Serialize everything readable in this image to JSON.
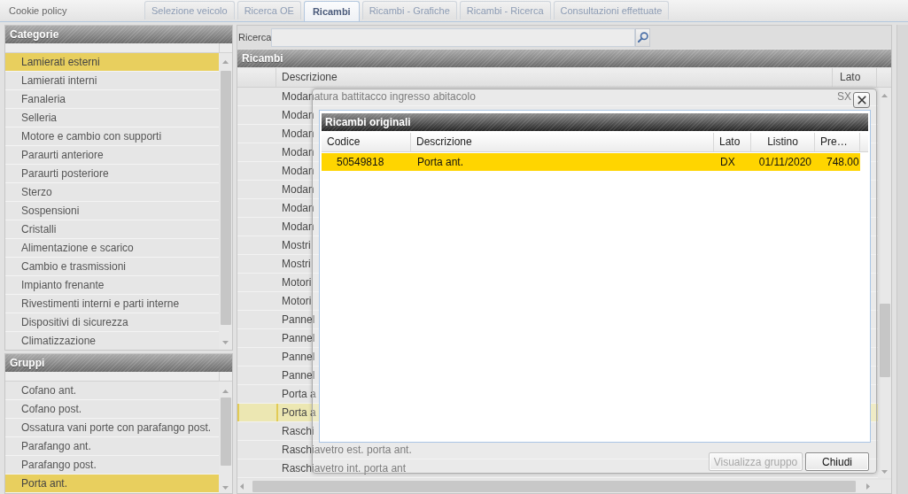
{
  "top_bar": {
    "cookie_link": "Cookie policy",
    "tabs": [
      {
        "label": "Selezione veicolo",
        "selected": false
      },
      {
        "label": "Ricerca OE",
        "selected": false
      },
      {
        "label": "Ricambi",
        "selected": true
      },
      {
        "label": "Ricambi - Grafiche",
        "selected": false
      },
      {
        "label": "Ricambi - Ricerca",
        "selected": false
      },
      {
        "label": "Consultazioni effettuate",
        "selected": false
      }
    ]
  },
  "categories": {
    "title": "Categorie",
    "items": [
      {
        "label": "Lamierati esterni",
        "selected": true
      },
      {
        "label": "Lamierati interni",
        "selected": false
      },
      {
        "label": "Fanaleria",
        "selected": false
      },
      {
        "label": "Selleria",
        "selected": false
      },
      {
        "label": "Motore e cambio con supporti",
        "selected": false
      },
      {
        "label": "Paraurti anteriore",
        "selected": false
      },
      {
        "label": "Paraurti posteriore",
        "selected": false
      },
      {
        "label": "Sterzo",
        "selected": false
      },
      {
        "label": "Sospensioni",
        "selected": false
      },
      {
        "label": "Cristalli",
        "selected": false
      },
      {
        "label": "Alimentazione e scarico",
        "selected": false
      },
      {
        "label": "Cambio e trasmissioni",
        "selected": false
      },
      {
        "label": "Impianto frenante",
        "selected": false
      },
      {
        "label": "Rivestimenti interni e parti interne",
        "selected": false
      },
      {
        "label": "Dispositivi di sicurezza",
        "selected": false
      },
      {
        "label": "Climatizzazione",
        "selected": false
      }
    ]
  },
  "groups": {
    "title": "Gruppi",
    "items": [
      {
        "label": "Cofano ant.",
        "selected": false
      },
      {
        "label": "Cofano post.",
        "selected": false
      },
      {
        "label": "Ossatura vani porte con parafango post.",
        "selected": false
      },
      {
        "label": "Parafango ant.",
        "selected": false
      },
      {
        "label": "Parafango post.",
        "selected": false
      },
      {
        "label": "Porta ant.",
        "selected": true
      }
    ]
  },
  "search": {
    "label": "Ricerca"
  },
  "parts": {
    "title": "Ricambi",
    "columns": [
      "Descrizione",
      "Lato"
    ],
    "rows": [
      {
        "description": "Modanatura battitacco ingresso abitacolo",
        "side": "SX",
        "selected": false
      },
      {
        "description": "Modan",
        "selected": false
      },
      {
        "description": "Modan",
        "selected": false
      },
      {
        "description": "Modan",
        "selected": false
      },
      {
        "description": "Modan",
        "selected": false
      },
      {
        "description": "Modan",
        "selected": false
      },
      {
        "description": "Modan",
        "selected": false
      },
      {
        "description": "Modan",
        "selected": false
      },
      {
        "description": "Mostri",
        "selected": false
      },
      {
        "description": "Mostri",
        "selected": false
      },
      {
        "description": "Motori",
        "selected": false
      },
      {
        "description": "Motori",
        "selected": false
      },
      {
        "description": "Pannel",
        "selected": false
      },
      {
        "description": "Pannel",
        "selected": false
      },
      {
        "description": "Pannel",
        "selected": false
      },
      {
        "description": "Pannel",
        "selected": false
      },
      {
        "description": "Porta a",
        "selected": false
      },
      {
        "description": "Porta a",
        "selected": true
      },
      {
        "description": "Raschi",
        "selected": false
      },
      {
        "description": "Raschiavetro est. porta ant.",
        "selected": false
      },
      {
        "description": "Raschiavetro int. porta ant",
        "selected": false
      }
    ]
  },
  "dialog": {
    "title": "Ricambi originali",
    "columns": [
      "Codice",
      "Descrizione",
      "Lato",
      "Listino",
      "Pre…"
    ],
    "rows": [
      {
        "cells": [
          "50549818",
          "Porta ant.",
          "DX",
          "01/11/2020",
          "748.00"
        ],
        "selected": true
      }
    ],
    "buttons": [
      {
        "label": "Visualizza gruppo",
        "disabled": true
      },
      {
        "label": "Chiudi",
        "disabled": false
      }
    ]
  }
}
